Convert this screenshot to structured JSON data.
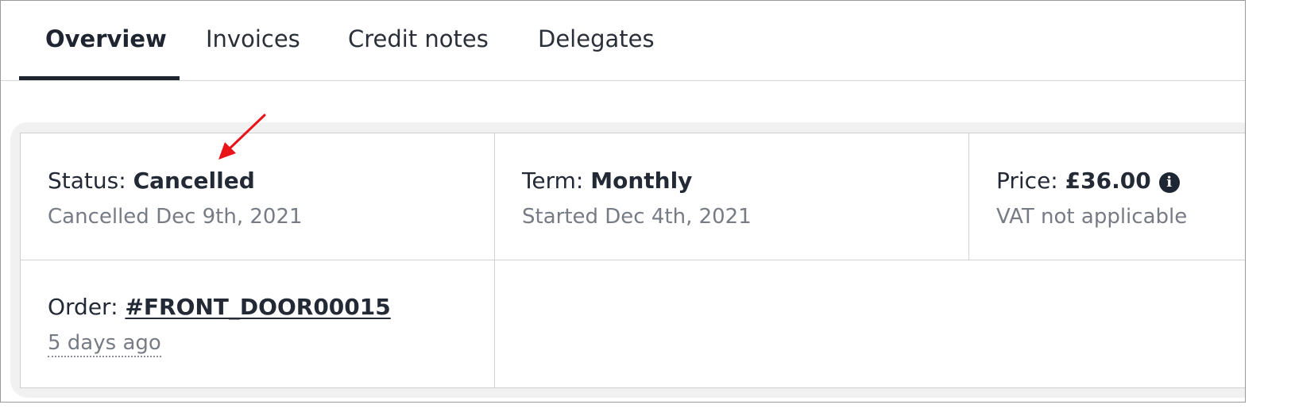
{
  "tabs": [
    {
      "label": "Overview",
      "active": true
    },
    {
      "label": "Invoices",
      "active": false
    },
    {
      "label": "Credit notes",
      "active": false
    },
    {
      "label": "Delegates",
      "active": false
    }
  ],
  "status": {
    "label": "Status:",
    "value": "Cancelled",
    "sub": "Cancelled Dec 9th, 2021"
  },
  "term": {
    "label": "Term:",
    "value": "Monthly",
    "sub": "Started Dec 4th, 2021"
  },
  "price": {
    "label": "Price:",
    "value": "£36.00",
    "sub": "VAT not applicable",
    "info_icon": "info-circle-icon"
  },
  "order": {
    "label": "Order:",
    "value": "#FRONT_DOOR00015",
    "sub": "5 days ago"
  },
  "annotation": {
    "arrow_color": "#e8141a"
  },
  "colors": {
    "text_dark": "#1f2633",
    "text_muted": "#777c84",
    "border": "#d2d2d2"
  }
}
